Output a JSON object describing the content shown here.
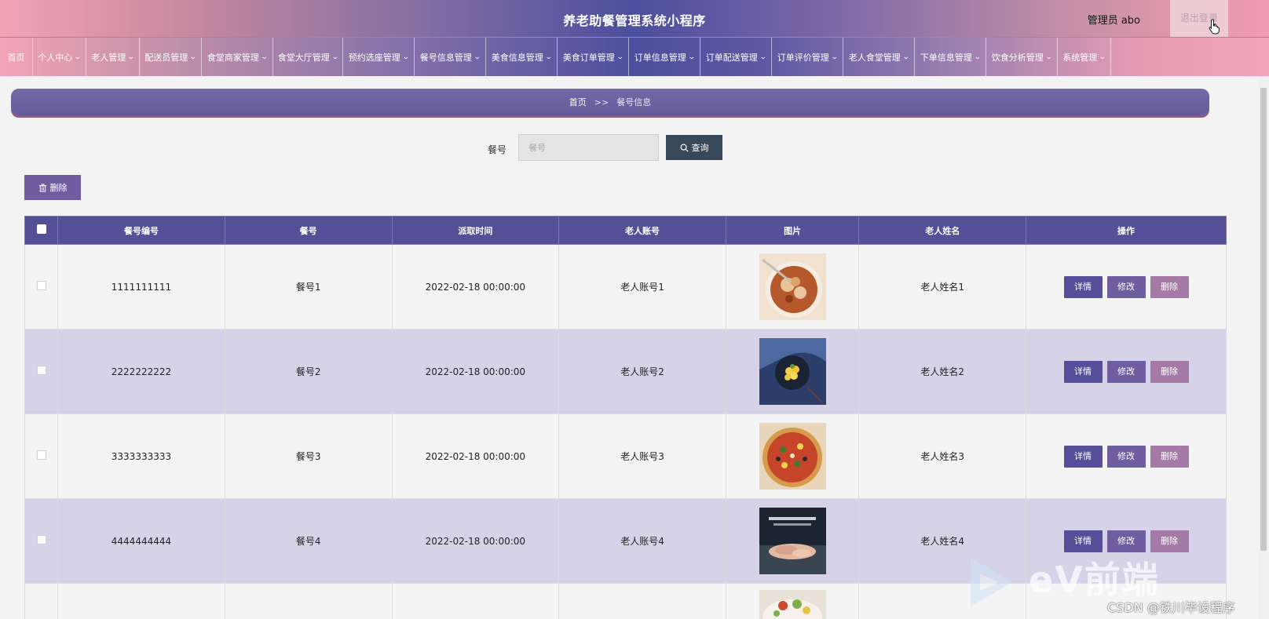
{
  "header": {
    "title": "养老助餐管理系统小程序",
    "admin_label": "管理员 abo",
    "logout_label": "退出登录"
  },
  "nav": {
    "items": [
      {
        "label": "首页",
        "has_dropdown": false
      },
      {
        "label": "个人中心",
        "has_dropdown": true
      },
      {
        "label": "老人管理",
        "has_dropdown": true
      },
      {
        "label": "配送员管理",
        "has_dropdown": true
      },
      {
        "label": "食堂商家管理",
        "has_dropdown": true
      },
      {
        "label": "食堂大厅管理",
        "has_dropdown": true
      },
      {
        "label": "预约选座管理",
        "has_dropdown": true
      },
      {
        "label": "餐号信息管理",
        "has_dropdown": true
      },
      {
        "label": "美食信息管理",
        "has_dropdown": true
      },
      {
        "label": "美食订单管理",
        "has_dropdown": true
      },
      {
        "label": "订单信息管理",
        "has_dropdown": true
      },
      {
        "label": "订单配送管理",
        "has_dropdown": true
      },
      {
        "label": "订单评价管理",
        "has_dropdown": true
      },
      {
        "label": "老人食堂管理",
        "has_dropdown": true
      },
      {
        "label": "下单信息管理",
        "has_dropdown": true
      },
      {
        "label": "饮食分析管理",
        "has_dropdown": true
      },
      {
        "label": "系统管理",
        "has_dropdown": true
      }
    ]
  },
  "breadcrumb": {
    "home": "首页",
    "separator": ">>",
    "current": "餐号信息"
  },
  "search": {
    "label": "餐号",
    "placeholder": "餐号",
    "button_label": "查询"
  },
  "toolbar": {
    "delete_label": "删除"
  },
  "table": {
    "columns": [
      "餐号编号",
      "餐号",
      "派取时间",
      "老人账号",
      "图片",
      "老人姓名",
      "操作"
    ],
    "rows": [
      {
        "code": "1111111111",
        "meal_no": "餐号1",
        "time": "2022-02-18 00:00:00",
        "account": "老人账号1",
        "image": "noodle-soup-dish",
        "name": "老人姓名1"
      },
      {
        "code": "2222222222",
        "meal_no": "餐号2",
        "time": "2022-02-18 00:00:00",
        "account": "老人账号2",
        "image": "fruit-bowl-dish",
        "name": "老人姓名2"
      },
      {
        "code": "3333333333",
        "meal_no": "餐号3",
        "time": "2022-02-18 00:00:00",
        "account": "老人账号3",
        "image": "pizza-dish",
        "name": "老人姓名3"
      },
      {
        "code": "4444444444",
        "meal_no": "餐号4",
        "time": "2022-02-18 00:00:00",
        "account": "老人账号4",
        "image": "roasted-food-dish",
        "name": "老人姓名4"
      }
    ],
    "actions": {
      "detail": "详情",
      "edit": "修改",
      "delete": "删除"
    }
  },
  "watermark": {
    "logo_text": "eV前端",
    "csdn": "CSDN @铁川毕设程序"
  },
  "colors": {
    "header_center": "#4c4f9d",
    "header_edge": "#f2a3b4",
    "table_header": "#545097",
    "row_alt": "#d6d3e8",
    "query_button": "#37485a",
    "detail_button": "#554e99",
    "edit_button": "#6f5e9f",
    "delete_button": "#a57aa6"
  }
}
